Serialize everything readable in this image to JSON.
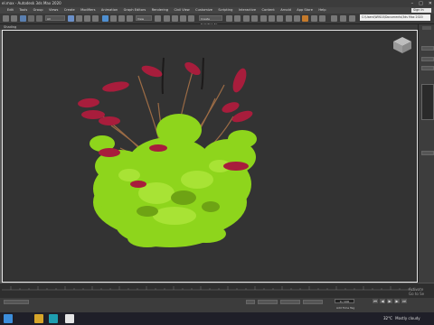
{
  "window": {
    "title": "el.max - Autodesk 3ds Max 2020",
    "controls": [
      "–",
      "□",
      "✕"
    ]
  },
  "menu": {
    "items": [
      "Edit",
      "Tools",
      "Group",
      "Views",
      "Create",
      "Modifiers",
      "Animation",
      "Graph Editors",
      "Rendering",
      "Civil View",
      "Customize",
      "Scripting",
      "Interactive",
      "Content",
      "Arnold",
      "App Store",
      "Help"
    ]
  },
  "signin": {
    "label": "Sign In"
  },
  "toolbar": {
    "selection_filter": "All",
    "view_select": "View",
    "create_selection_set": "Create Selection Se",
    "workspace_path": "C:\\Users\\WIN10\\Documents\\3ds Max 2020"
  },
  "viewport": {
    "label": "[+] [Perspective] [Standard] [Default Shading]",
    "visible_label": "Shading"
  },
  "status": {
    "frame": "0 / 100",
    "coords": "X: 0,0 Y: 0,0",
    "grid": "Grid = 10,0cm",
    "frame_counter": "0",
    "add_time_tag": "Add Time Tag",
    "auto_key": "Auto Key",
    "set_key": "Set K."
  },
  "activation": {
    "line1": "Activate",
    "line2": "Go to Se"
  },
  "taskbar": {
    "weather_temp": "32°C",
    "weather_desc": "Mostly cloudy"
  },
  "colors": {
    "leaf_green": "#8ed51c",
    "flower_red": "#a81d3c",
    "stem": "#9b6b45"
  }
}
